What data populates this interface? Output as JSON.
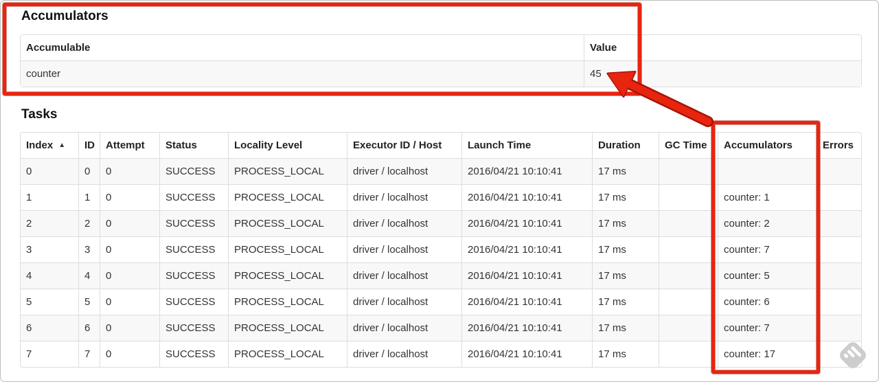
{
  "page": {
    "accumulators_heading": "Accumulators",
    "tasks_heading": "Tasks"
  },
  "accumulators_table": {
    "headers": [
      {
        "label": "Accumulable"
      },
      {
        "label": "Value"
      }
    ],
    "rows": [
      [
        "counter",
        "45"
      ]
    ]
  },
  "tasks_table": {
    "headers": [
      {
        "label": "Index",
        "sort_glyph": "▲"
      },
      {
        "label": "ID"
      },
      {
        "label": "Attempt"
      },
      {
        "label": "Status"
      },
      {
        "label": "Locality Level"
      },
      {
        "label": "Executor ID / Host"
      },
      {
        "label": "Launch Time"
      },
      {
        "label": "Duration"
      },
      {
        "label": "GC Time"
      },
      {
        "label": "Accumulators"
      },
      {
        "label": "Errors"
      }
    ],
    "rows": [
      [
        "0",
        "0",
        "0",
        "SUCCESS",
        "PROCESS_LOCAL",
        "driver / localhost",
        "2016/04/21 10:10:41",
        "17 ms",
        "",
        "",
        ""
      ],
      [
        "1",
        "1",
        "0",
        "SUCCESS",
        "PROCESS_LOCAL",
        "driver / localhost",
        "2016/04/21 10:10:41",
        "17 ms",
        "",
        "counter: 1",
        ""
      ],
      [
        "2",
        "2",
        "0",
        "SUCCESS",
        "PROCESS_LOCAL",
        "driver / localhost",
        "2016/04/21 10:10:41",
        "17 ms",
        "",
        "counter: 2",
        ""
      ],
      [
        "3",
        "3",
        "0",
        "SUCCESS",
        "PROCESS_LOCAL",
        "driver / localhost",
        "2016/04/21 10:10:41",
        "17 ms",
        "",
        "counter: 7",
        ""
      ],
      [
        "4",
        "4",
        "0",
        "SUCCESS",
        "PROCESS_LOCAL",
        "driver / localhost",
        "2016/04/21 10:10:41",
        "17 ms",
        "",
        "counter: 5",
        ""
      ],
      [
        "5",
        "5",
        "0",
        "SUCCESS",
        "PROCESS_LOCAL",
        "driver / localhost",
        "2016/04/21 10:10:41",
        "17 ms",
        "",
        "counter: 6",
        ""
      ],
      [
        "6",
        "6",
        "0",
        "SUCCESS",
        "PROCESS_LOCAL",
        "driver / localhost",
        "2016/04/21 10:10:41",
        "17 ms",
        "",
        "counter: 7",
        ""
      ],
      [
        "7",
        "7",
        "0",
        "SUCCESS",
        "PROCESS_LOCAL",
        "driver / localhost",
        "2016/04/21 10:10:41",
        "17 ms",
        "",
        "counter: 17",
        ""
      ]
    ]
  },
  "annotations": {
    "highlight_color": "#e8250f",
    "highlight_edge_color": "#a81408"
  },
  "icons": {
    "sort_ascending": "▲",
    "watermark": "feedly-icon"
  }
}
